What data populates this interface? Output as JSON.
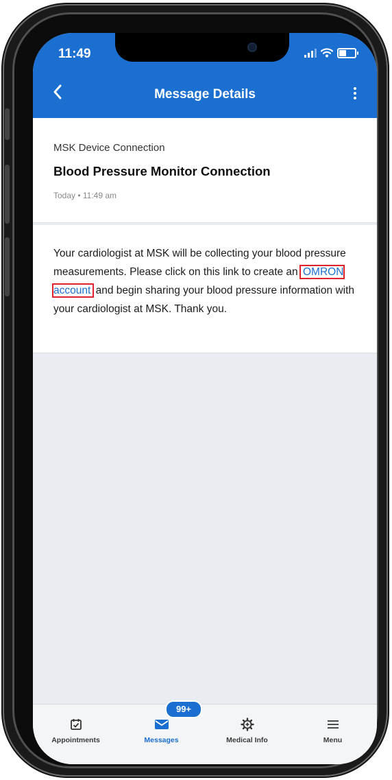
{
  "status_bar": {
    "time": "11:49"
  },
  "header": {
    "title": "Message Details",
    "back_icon": "chevron-left-icon",
    "more_icon": "vertical-ellipsis-icon",
    "background_color": "#1a6fd1"
  },
  "message": {
    "category": "MSK Device Connection",
    "subject": "Blood Pressure Monitor Connection",
    "date": "Today • 11:49 am",
    "body_before_link": "Your cardiologist at MSK will be collecting your blood pressure measurements. Please click on this link to create an ",
    "link_text": "OMRON account",
    "body_after_link": " and begin sharing your blood pressure information with your cardiologist at MSK. Thank you."
  },
  "tabbar": {
    "tabs": [
      {
        "label": "Appointments",
        "icon": "calendar-check-icon"
      },
      {
        "label": "Messages",
        "icon": "envelope-icon",
        "badge": "99+",
        "active": true
      },
      {
        "label": "Medical Info",
        "icon": "medical-gear-icon"
      },
      {
        "label": "Menu",
        "icon": "hamburger-menu-icon"
      }
    ]
  },
  "colors": {
    "accent": "#1a6fd1",
    "highlight_outline": "#e0202a"
  }
}
